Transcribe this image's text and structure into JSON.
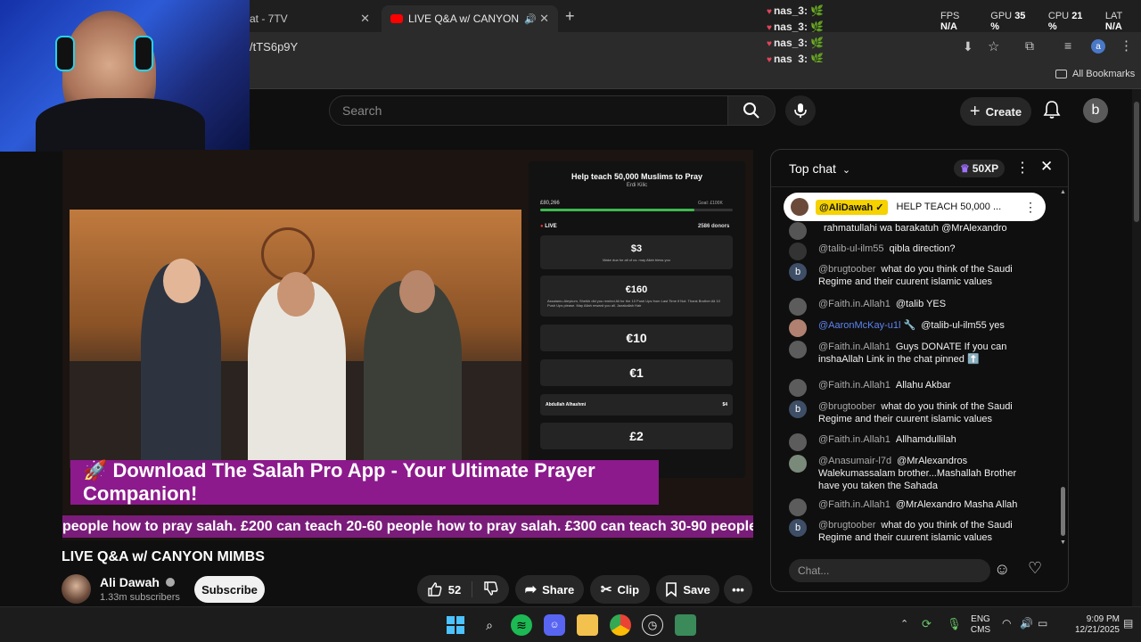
{
  "browser": {
    "tabs": [
      {
        "label": "at - 7TV"
      },
      {
        "label": "LIVE Q&A w/ CANYON MIMB"
      }
    ],
    "address": "/tTS6p9Y",
    "bookmarks_label": "All Bookmarks",
    "overlay_users": [
      "nas_3:",
      "nas_3:",
      "nas_3:",
      "nas_3:"
    ],
    "stats": {
      "fps_label": "FPS",
      "fps_value": "N/A",
      "gpu_label": "GPU",
      "gpu_value": "35 %",
      "cpu_label": "CPU",
      "cpu_value": "21 %",
      "lat_label": "LAT",
      "lat_value": "N/A"
    }
  },
  "youtube": {
    "search_placeholder": "Search",
    "create_label": "Create",
    "avatar_letter": "b"
  },
  "video": {
    "panel": {
      "title": "Help teach 50,000 Muslims to Pray",
      "organizer": "Erdi Kilic",
      "raised": "£80,266",
      "goal": "Goal: £100K",
      "progress": 0.8,
      "live_label": "LIVE",
      "donors": "2586 donors",
      "donations": [
        {
          "amount": "$3",
          "note": "Make dua for all of us. may Allah bless you"
        },
        {
          "amount": "€160",
          "note": "Assalamu Aleykum, Sheikh did you remind Ali for the 10 Push Ups from Last Time if Not. Thank Brother Ali 10 Push Ups please. May Allah reward you all. Jazakallah Hair"
        },
        {
          "amount": "€10",
          "note": ""
        },
        {
          "amount": "€1",
          "note": ""
        },
        {
          "amount": "$4",
          "note": "Abdullah Alhashmi"
        },
        {
          "amount": "£2",
          "note": ""
        }
      ]
    },
    "banner": "🚀 Download The Salah Pro App - Your Ultimate Prayer Companion!",
    "ticker": "people how to pray salah. £200 can teach 20-60 people how to pray salah. £300 can teach 30-90 people"
  },
  "watch": {
    "title": "LIVE Q&A w/ CANYON MIMBS",
    "channel": "Ali Dawah",
    "subscribers": "1.33m subscribers",
    "subscribe_label": "Subscribe",
    "likes": "52",
    "share_label": "Share",
    "clip_label": "Clip",
    "save_label": "Save"
  },
  "chat": {
    "header": "Top chat",
    "xp": "50XP",
    "pinned": {
      "author": "@AliDawah",
      "text": "HELP TEACH 50,000 ..."
    },
    "messages": [
      {
        "author": "",
        "text": "rahmatullahi wa barakatuh @MrAlexandro",
        "avatar": "",
        "avatar_color": "#555555"
      },
      {
        "author": "@talib-ul-ilm55",
        "text": "qibla direction?",
        "avatar": "",
        "avatar_color": "#333333"
      },
      {
        "author": "@brugtoober",
        "text": "what do you think of the Saudi Regime and their cuurent islamic values",
        "avatar": "b",
        "avatar_color": "#3d4e66"
      },
      {
        "author": "@Faith.in.Allah1",
        "text": "@talib YES",
        "avatar": "",
        "avatar_color": "#5c5c5c"
      },
      {
        "author": "@AaronMcKay-u1l 🔧",
        "text": "@talib-ul-ilm55 yes",
        "avatar": "",
        "avatar_color": "#b08070",
        "mod": true
      },
      {
        "author": "@Faith.in.Allah1",
        "text": "Guys DONATE If you can inshaAllah Link in the chat pinned ⬆️",
        "avatar": "",
        "avatar_color": "#5c5c5c"
      },
      {
        "author": "@Faith.in.Allah1",
        "text": "Allahu Akbar",
        "avatar": "",
        "avatar_color": "#5c5c5c"
      },
      {
        "author": "@brugtoober",
        "text": "what do you think of the Saudi Regime and their cuurent islamic values",
        "avatar": "b",
        "avatar_color": "#3d4e66"
      },
      {
        "author": "@Faith.in.Allah1",
        "text": "Allhamdullilah",
        "avatar": "",
        "avatar_color": "#5c5c5c"
      },
      {
        "author": "@Anasumair-l7d",
        "text": "@MrAlexandros Walekumassalam brother...Mashallah Brother have you taken the Sahada",
        "avatar": "",
        "avatar_color": "#7a8a7a"
      },
      {
        "author": "@Faith.in.Allah1",
        "text": "@MrAlexandro Masha Allah",
        "avatar": "",
        "avatar_color": "#5c5c5c"
      },
      {
        "author": "@brugtoober",
        "text": "what do you think of the Saudi Regime and their cuurent islamic values",
        "avatar": "b",
        "avatar_color": "#3d4e66"
      }
    ],
    "input_placeholder": "Chat..."
  },
  "taskbar": {
    "lang_top": "ENG",
    "lang_bottom": "CMS",
    "time": "9:09 PM",
    "date": "12/21/2025"
  }
}
